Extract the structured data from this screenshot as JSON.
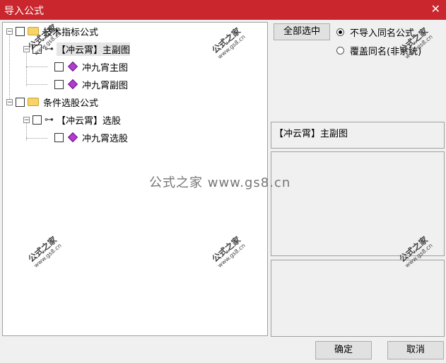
{
  "window": {
    "title": "导入公式",
    "close_glyph": "✕"
  },
  "tree": {
    "root1": {
      "label": "技术指标公式"
    },
    "child1": {
      "label": "【冲云霄】主副图"
    },
    "leaf1": {
      "label": "冲九宵主图"
    },
    "leaf2": {
      "label": "冲九霄副图"
    },
    "root2": {
      "label": "条件选股公式"
    },
    "child2": {
      "label": "【冲云霄】选股"
    },
    "leaf3": {
      "label": "冲九霄选股"
    }
  },
  "right": {
    "select_all_label": "全部选中",
    "radio_skip_label": "不导入同名公式",
    "radio_overwrite_label": "覆盖同名(非系统)",
    "selected_formula": "【冲云霄】主副图"
  },
  "footer": {
    "ok_label": "确定",
    "cancel_label": "取消"
  },
  "watermark": {
    "brand": "公式之家",
    "url": "www.gs8.cn",
    "center_text": "公式之家 www.gs8.cn"
  }
}
